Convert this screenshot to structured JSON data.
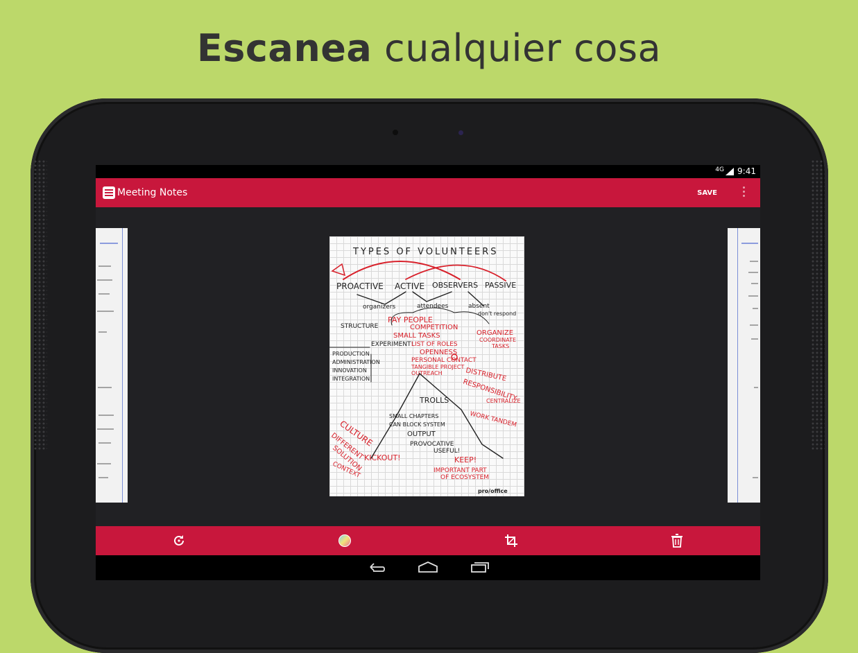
{
  "headline": {
    "bold": "Escanea",
    "rest": "cualquier cosa"
  },
  "status": {
    "signal": "4G",
    "time": "9:41"
  },
  "app": {
    "title": "Meeting Notes",
    "save_label": "SAVE"
  },
  "document": {
    "heading": "TYPES OF VOLUNTEERS",
    "row": [
      "PROACTIVE",
      "ACTIVE",
      "OBSERVERS",
      "PASSIVE"
    ],
    "sub": [
      "organizers",
      "attendees",
      "absent",
      "don't respond"
    ],
    "red1": [
      "PAY PEOPLE",
      "COMPETITION",
      "SMALL TASKS",
      "LIST OF ROLES",
      "OPENNESS",
      "PERSONAL CONTACT",
      "TANGIBLE PROJECT",
      "OUTREACH"
    ],
    "black1": [
      "STRUCTURE",
      "EXPERIMENT!",
      "PRODUCTION",
      "ADMINISTRATION",
      "INNOVATION",
      "INTEGRATION"
    ],
    "right1": [
      "ORGANIZE",
      "COORDINATE",
      "TASKS",
      "DISTRIBUTE",
      "RESPONSIBILITY",
      "CENTRALIZE",
      "WORK TANDEM"
    ],
    "bottom": [
      "TROLLS",
      "SMALL CHAPTERS",
      "CAN BLOCK SYSTEM",
      "OUTPUT",
      "PROVOCATIVE",
      "USEFUL!",
      "KEEP!",
      "IMPORTANT PART",
      "OF ECOSYSTEM",
      "CULTURE",
      "DIFFERENT",
      "SOLUTION",
      "KICKOUT!",
      "CONTEXT"
    ],
    "brand": "pro/office"
  },
  "icons": {
    "app": "scanner-icon",
    "overflow": "overflow-menu-icon",
    "rotate": "rotate-icon",
    "color": "color-filter-icon",
    "crop": "crop-icon",
    "delete": "trash-icon",
    "back": "back-icon",
    "home": "home-icon",
    "recents": "recents-icon"
  },
  "colors": {
    "background": "#bcd86a",
    "accent": "#c8173c",
    "ink_red": "#d8202a"
  }
}
